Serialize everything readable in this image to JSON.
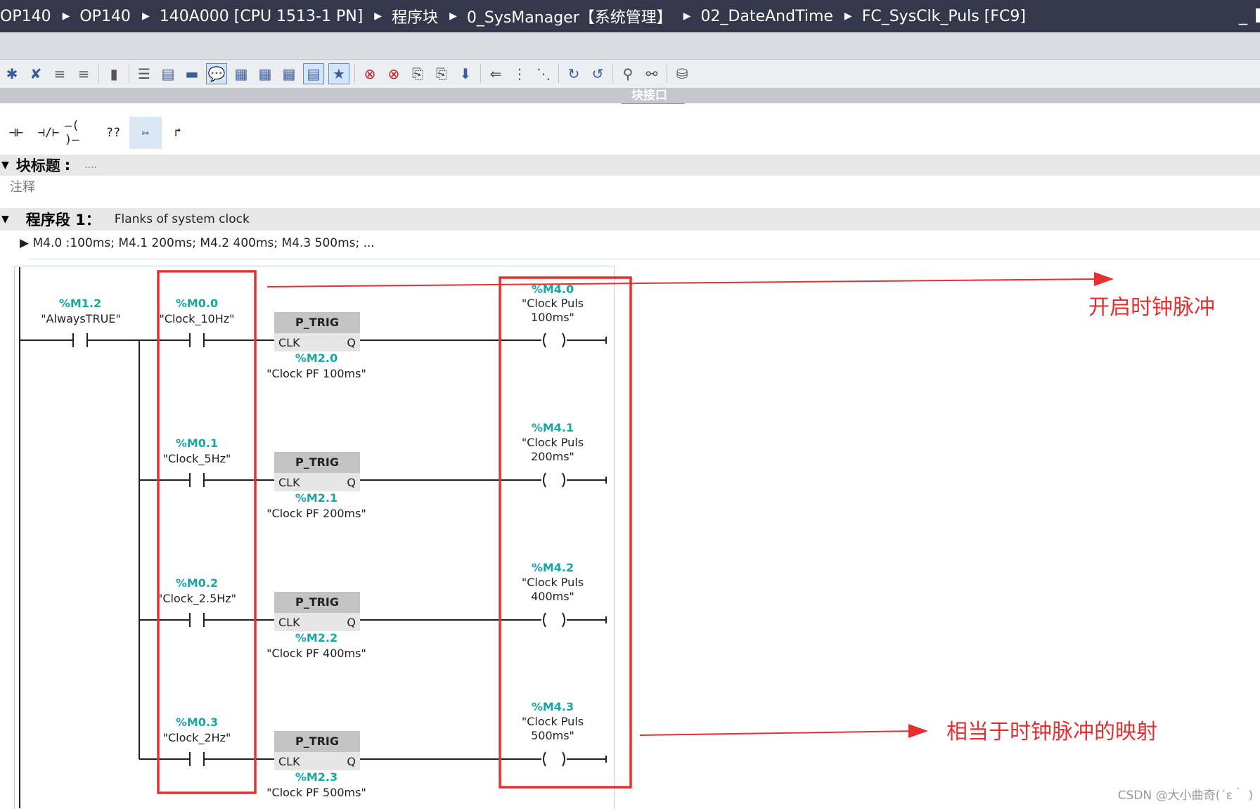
{
  "titlebar": {
    "crumbs": [
      "OP140",
      "OP140",
      "140A000 [CPU 1513-1 PN]",
      "程序块",
      "0_SysManager【系统管理】",
      "02_DateAndTime",
      "FC_SysClk_Puls [FC9]"
    ],
    "minimize": "_"
  },
  "interface_bar": {
    "label": "块接口"
  },
  "ladder_toolbar": [
    "⊣⊢",
    "⊣/⊢",
    "–( )–",
    "??",
    "↦",
    "↱"
  ],
  "block": {
    "title_label": "块标题",
    "title_value": "....",
    "comment_placeholder": "注释"
  },
  "network": {
    "label": "程序段 1：",
    "title": "Flanks of system clock",
    "comment": "M4.0 :100ms; M4.1 200ms; M4.2  400ms;  M4.3  500ms; ..."
  },
  "always_true": {
    "address": "%M1.2",
    "symbol": "\"AlwaysTRUE\""
  },
  "rungs": [
    {
      "contact_addr": "%M0.0",
      "contact_sym": "\"Clock_10Hz\"",
      "box_title": "P_TRIG",
      "clk": "CLK",
      "q": "Q",
      "mem_addr": "%M2.0",
      "mem_sym": "\"Clock PF 100ms\"",
      "coil_addr": "%M4.0",
      "coil_sym1": "\"Clock Puls",
      "coil_sym2": "100ms\""
    },
    {
      "contact_addr": "%M0.1",
      "contact_sym": "\"Clock_5Hz\"",
      "box_title": "P_TRIG",
      "clk": "CLK",
      "q": "Q",
      "mem_addr": "%M2.1",
      "mem_sym": "\"Clock PF 200ms\"",
      "coil_addr": "%M4.1",
      "coil_sym1": "\"Clock Puls",
      "coil_sym2": "200ms\""
    },
    {
      "contact_addr": "%M0.2",
      "contact_sym": "\"Clock_2.5Hz\"",
      "box_title": "P_TRIG",
      "clk": "CLK",
      "q": "Q",
      "mem_addr": "%M2.2",
      "mem_sym": "\"Clock PF 400ms\"",
      "coil_addr": "%M4.2",
      "coil_sym1": "\"Clock Puls",
      "coil_sym2": "400ms\""
    },
    {
      "contact_addr": "%M0.3",
      "contact_sym": "\"Clock_2Hz\"",
      "box_title": "P_TRIG",
      "clk": "CLK",
      "q": "Q",
      "mem_addr": "%M2.3",
      "mem_sym": "\"Clock PF 500ms\"",
      "coil_addr": "%M4.3",
      "coil_sym1": "\"Clock Puls",
      "coil_sym2": "500ms\""
    }
  ],
  "annotations": {
    "top": "开启时钟脉冲",
    "bottom": "相当于时钟脉冲的映射",
    "color": "#e63030"
  },
  "watermark": "CSDN @大小曲奇(´ε｀ )"
}
